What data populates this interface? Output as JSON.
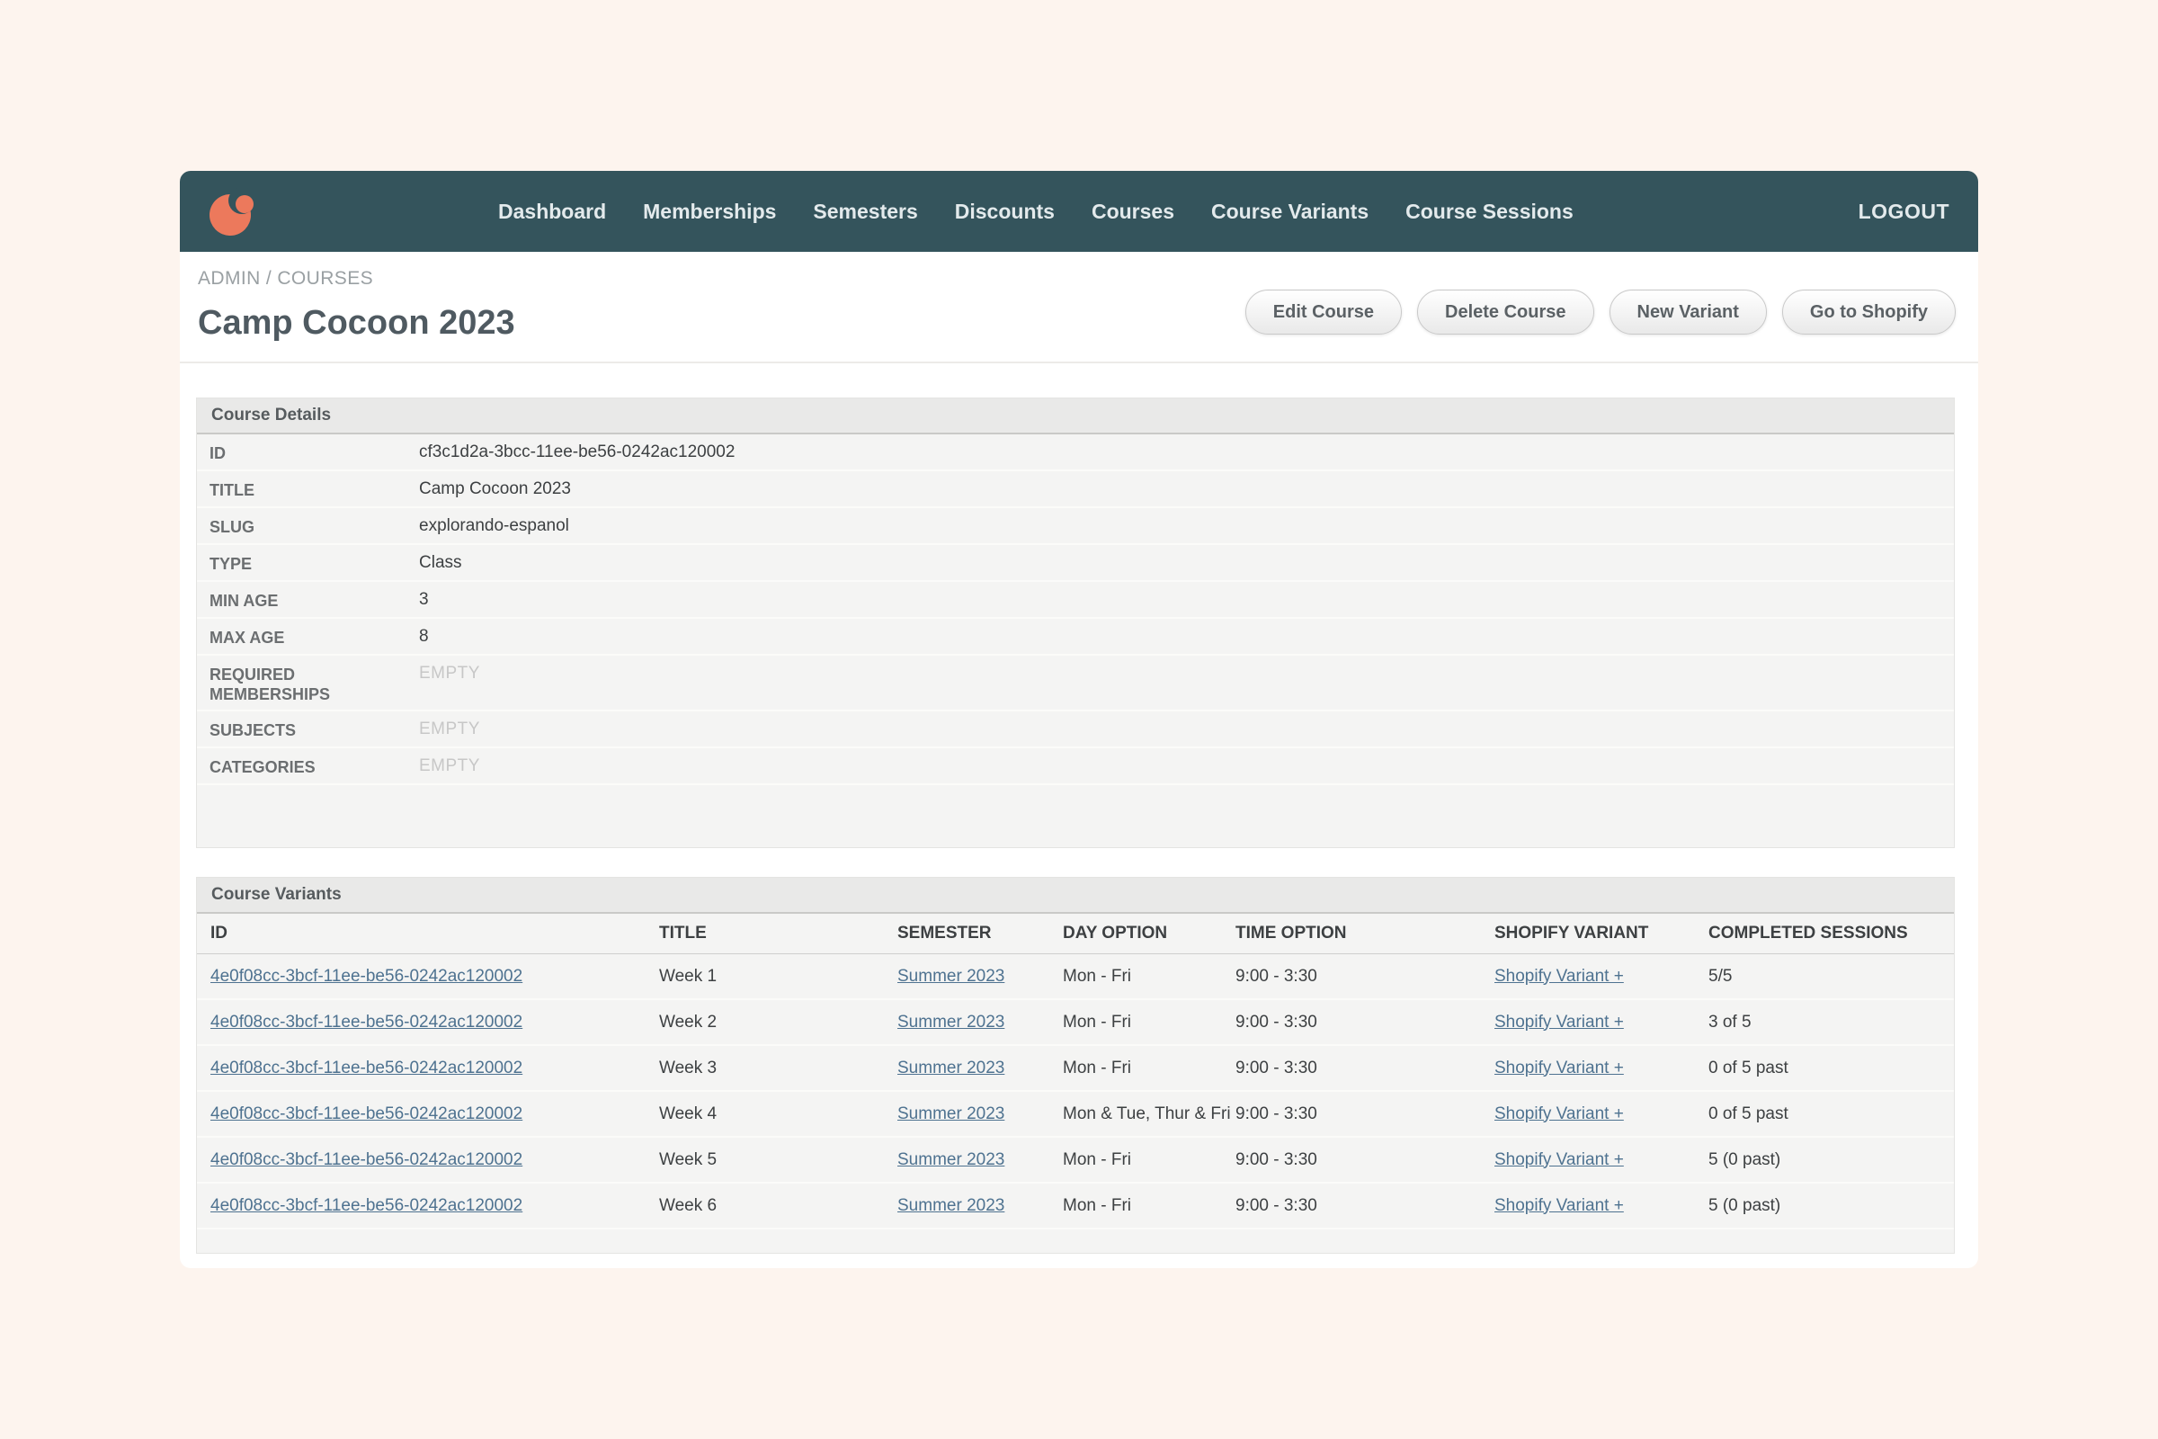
{
  "colors": {
    "page_background": "#fdf4ee",
    "nav_background": "#34545c",
    "brand_coral": "#ec795c",
    "link_color": "#4e7290",
    "panel_background": "#f4f4f3"
  },
  "nav": {
    "items": [
      {
        "label": "Dashboard"
      },
      {
        "label": "Memberships"
      },
      {
        "label": "Semesters"
      },
      {
        "label": "Discounts"
      },
      {
        "label": "Courses"
      },
      {
        "label": "Course Variants"
      },
      {
        "label": "Course Sessions"
      }
    ],
    "logout_label": "LOGOUT"
  },
  "breadcrumb": {
    "text": "ADMIN / COURSES"
  },
  "page": {
    "title": "Camp Cocoon 2023"
  },
  "actions": {
    "edit_course": "Edit Course",
    "delete_course": "Delete Course",
    "new_variant": "New Variant",
    "go_to_shopify": "Go to Shopify"
  },
  "course_details": {
    "title": "Course Details",
    "rows": [
      {
        "label": "ID",
        "value": "cf3c1d2a-3bcc-11ee-be56-0242ac120002"
      },
      {
        "label": "TITLE",
        "value": "Camp Cocoon 2023"
      },
      {
        "label": "SLUG",
        "value": "explorando-espanol"
      },
      {
        "label": "TYPE",
        "value": "Class"
      },
      {
        "label": "MIN AGE",
        "value": "3"
      },
      {
        "label": "MAX AGE",
        "value": "8"
      },
      {
        "label": "REQUIRED MEMBERSHIPS",
        "value": "EMPTY"
      },
      {
        "label": "SUBJECTS",
        "value": "EMPTY"
      },
      {
        "label": "CATEGORIES",
        "value": "EMPTY"
      }
    ]
  },
  "course_variants": {
    "title": "Course Variants",
    "columns": [
      "ID",
      "TITLE",
      "SEMESTER",
      "DAY OPTION",
      "TIME OPTION",
      "SHOPIFY VARIANT",
      "COMPLETED SESSIONS"
    ],
    "rows": [
      {
        "id": "4e0f08cc-3bcf-11ee-be56-0242ac120002",
        "title": "Week 1",
        "semester": "Summer 2023",
        "day_option": "Mon - Fri",
        "time_option": "9:00 - 3:30",
        "shopify_variant": "Shopify Variant +",
        "completed_sessions": "5/5"
      },
      {
        "id": "4e0f08cc-3bcf-11ee-be56-0242ac120002",
        "title": "Week 2",
        "semester": "Summer 2023",
        "day_option": "Mon - Fri",
        "time_option": "9:00 - 3:30",
        "shopify_variant": "Shopify Variant +",
        "completed_sessions": "3 of 5"
      },
      {
        "id": "4e0f08cc-3bcf-11ee-be56-0242ac120002",
        "title": "Week 3",
        "semester": "Summer 2023",
        "day_option": "Mon - Fri",
        "time_option": "9:00 - 3:30",
        "shopify_variant": "Shopify Variant +",
        "completed_sessions": "0 of 5 past"
      },
      {
        "id": "4e0f08cc-3bcf-11ee-be56-0242ac120002",
        "title": "Week 4",
        "semester": "Summer 2023",
        "day_option": "Mon & Tue, Thur & Fri",
        "time_option": "9:00 - 3:30",
        "shopify_variant": "Shopify Variant +",
        "completed_sessions": "0 of 5 past"
      },
      {
        "id": "4e0f08cc-3bcf-11ee-be56-0242ac120002",
        "title": "Week 5",
        "semester": "Summer 2023",
        "day_option": "Mon - Fri",
        "time_option": "9:00 - 3:30",
        "shopify_variant": "Shopify Variant +",
        "completed_sessions": "5 (0 past)"
      },
      {
        "id": "4e0f08cc-3bcf-11ee-be56-0242ac120002",
        "title": "Week 6",
        "semester": "Summer 2023",
        "day_option": "Mon - Fri",
        "time_option": "9:00 - 3:30",
        "shopify_variant": "Shopify Variant +",
        "completed_sessions": "5 (0 past)"
      }
    ]
  }
}
